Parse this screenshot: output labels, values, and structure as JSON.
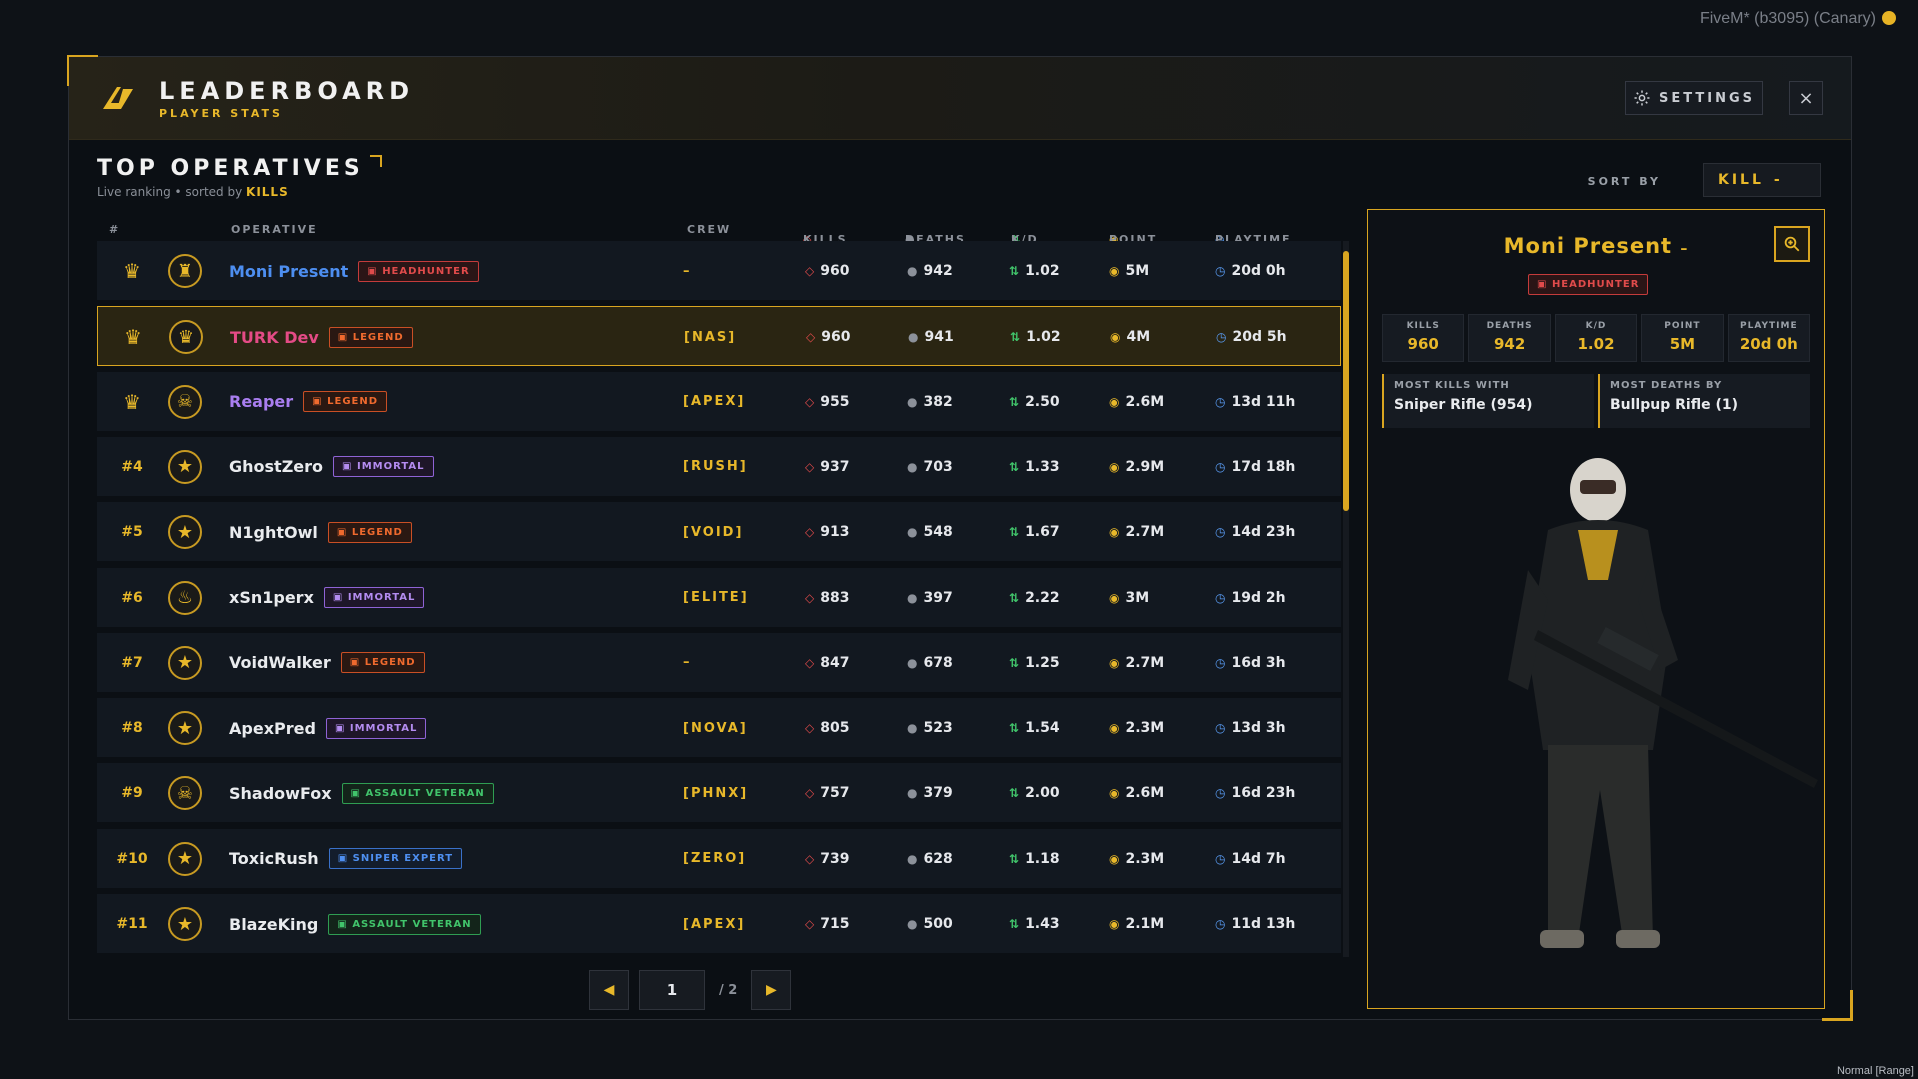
{
  "app": {
    "title": "LEADERBOARD",
    "subtitle": "PLAYER STATS",
    "settings_label": "SETTINGS",
    "close_label": "×"
  },
  "os": {
    "window_caption": "FiveM* (b3095) (Canary)",
    "status_text": "Normal [Range]"
  },
  "section": {
    "title": "TOP OPERATIVES",
    "subtitle_prefix": "Live ranking • sorted by ",
    "subtitle_sort": "KILLS"
  },
  "sort": {
    "label": "SORT BY",
    "value": "KILL",
    "caret": "-"
  },
  "columns": {
    "rank": "#",
    "operative": "OPERATIVE",
    "crew": "CREW",
    "kills": "KILLS",
    "deaths": "DEATHS",
    "kd": "K/D",
    "point": "POINT",
    "playtime": "PLAYTIME"
  },
  "rows": [
    {
      "rank": "",
      "crown": true,
      "name": "Moni Present",
      "name_color": "#4d8ef0",
      "badge": "HEADHUNTER",
      "badge_class": "b-headhunter",
      "crew": "–",
      "kills": "960",
      "deaths": "942",
      "kd": "1.02",
      "point": "5M",
      "playtime": "20d 0h",
      "avatar": "hunter-avatar-icon",
      "selected": false
    },
    {
      "rank": "",
      "crown": true,
      "name": "TURK Dev",
      "name_color": "#e44b86",
      "badge": "LEGEND",
      "badge_class": "b-legend",
      "crew": "[NAS]",
      "kills": "960",
      "deaths": "941",
      "kd": "1.02",
      "point": "4M",
      "playtime": "20d 5h",
      "avatar": "crown-avatar-icon",
      "selected": true
    },
    {
      "rank": "",
      "crown": true,
      "name": "Reaper",
      "name_color": "#a97ef0",
      "badge": "LEGEND",
      "badge_class": "b-legend",
      "crew": "[APEX]",
      "kills": "955",
      "deaths": "382",
      "kd": "2.50",
      "point": "2.6M",
      "playtime": "13d 11h",
      "avatar": "reaper-avatar-icon",
      "selected": false
    },
    {
      "rank": "#4",
      "crown": false,
      "name": "GhostZero",
      "name_color": "#e9ebee",
      "badge": "IMMORTAL",
      "badge_class": "b-immortal",
      "crew": "[RUSH]",
      "kills": "937",
      "deaths": "703",
      "kd": "1.33",
      "point": "2.9M",
      "playtime": "17d 18h",
      "avatar": "star-icon",
      "selected": false
    },
    {
      "rank": "#5",
      "crown": false,
      "name": "N1ghtOwl",
      "name_color": "#e9ebee",
      "badge": "LEGEND",
      "badge_class": "b-legend",
      "crew": "[VOID]",
      "kills": "913",
      "deaths": "548",
      "kd": "1.67",
      "point": "2.7M",
      "playtime": "14d 23h",
      "avatar": "star-icon",
      "selected": false
    },
    {
      "rank": "#6",
      "crown": false,
      "name": "xSn1perx",
      "name_color": "#e9ebee",
      "badge": "IMMORTAL",
      "badge_class": "b-immortal",
      "crew": "[ELITE]",
      "kills": "883",
      "deaths": "397",
      "kd": "2.22",
      "point": "3M",
      "playtime": "19d 2h",
      "avatar": "demon-avatar-icon",
      "selected": false
    },
    {
      "rank": "#7",
      "crown": false,
      "name": "VoidWalker",
      "name_color": "#e9ebee",
      "badge": "LEGEND",
      "badge_class": "b-legend",
      "crew": "–",
      "kills": "847",
      "deaths": "678",
      "kd": "1.25",
      "point": "2.7M",
      "playtime": "16d 3h",
      "avatar": "star-icon",
      "selected": false
    },
    {
      "rank": "#8",
      "crown": false,
      "name": "ApexPred",
      "name_color": "#e9ebee",
      "badge": "IMMORTAL",
      "badge_class": "b-immortal",
      "crew": "[NOVA]",
      "kills": "805",
      "deaths": "523",
      "kd": "1.54",
      "point": "2.3M",
      "playtime": "13d 3h",
      "avatar": "star-icon",
      "selected": false
    },
    {
      "rank": "#9",
      "crown": false,
      "name": "ShadowFox",
      "name_color": "#e9ebee",
      "badge": "ASSAULT VETERAN",
      "badge_class": "b-assault",
      "crew": "[PHNX]",
      "kills": "757",
      "deaths": "379",
      "kd": "2.00",
      "point": "2.6M",
      "playtime": "16d 23h",
      "avatar": "skull-avatar-icon",
      "selected": false
    },
    {
      "rank": "#10",
      "crown": false,
      "name": "ToxicRush",
      "name_color": "#e9ebee",
      "badge": "SNIPER EXPERT",
      "badge_class": "b-sniper",
      "crew": "[ZERO]",
      "kills": "739",
      "deaths": "628",
      "kd": "1.18",
      "point": "2.3M",
      "playtime": "14d 7h",
      "avatar": "star-icon",
      "selected": false
    },
    {
      "rank": "#11",
      "crown": false,
      "name": "BlazeKing",
      "name_color": "#e9ebee",
      "badge": "ASSAULT VETERAN",
      "badge_class": "b-assault",
      "crew": "[APEX]",
      "kills": "715",
      "deaths": "500",
      "kd": "1.43",
      "point": "2.1M",
      "playtime": "11d 13h",
      "avatar": "star-icon",
      "selected": false
    }
  ],
  "pager": {
    "prev": "◀",
    "next": "▶",
    "current": "1",
    "total": "/ 2"
  },
  "detail": {
    "name": "Moni Present",
    "name_suffix": "–",
    "badge": "HEADHUNTER",
    "stats": [
      {
        "label": "KILLS",
        "value": "960"
      },
      {
        "label": "DEATHS",
        "value": "942"
      },
      {
        "label": "K/D",
        "value": "1.02"
      },
      {
        "label": "POINT",
        "value": "5M"
      },
      {
        "label": "PLAYTIME",
        "value": "20d 0h"
      }
    ],
    "most_kills_label": "MOST KILLS WITH",
    "most_kills_value": "Sniper Rifle (954)",
    "most_deaths_label": "MOST DEATHS BY",
    "most_deaths_value": "Bullpup Rifle (1)"
  },
  "colors": {
    "accent": "#d9a520",
    "background": "#0b0f14",
    "row": "#121820"
  }
}
